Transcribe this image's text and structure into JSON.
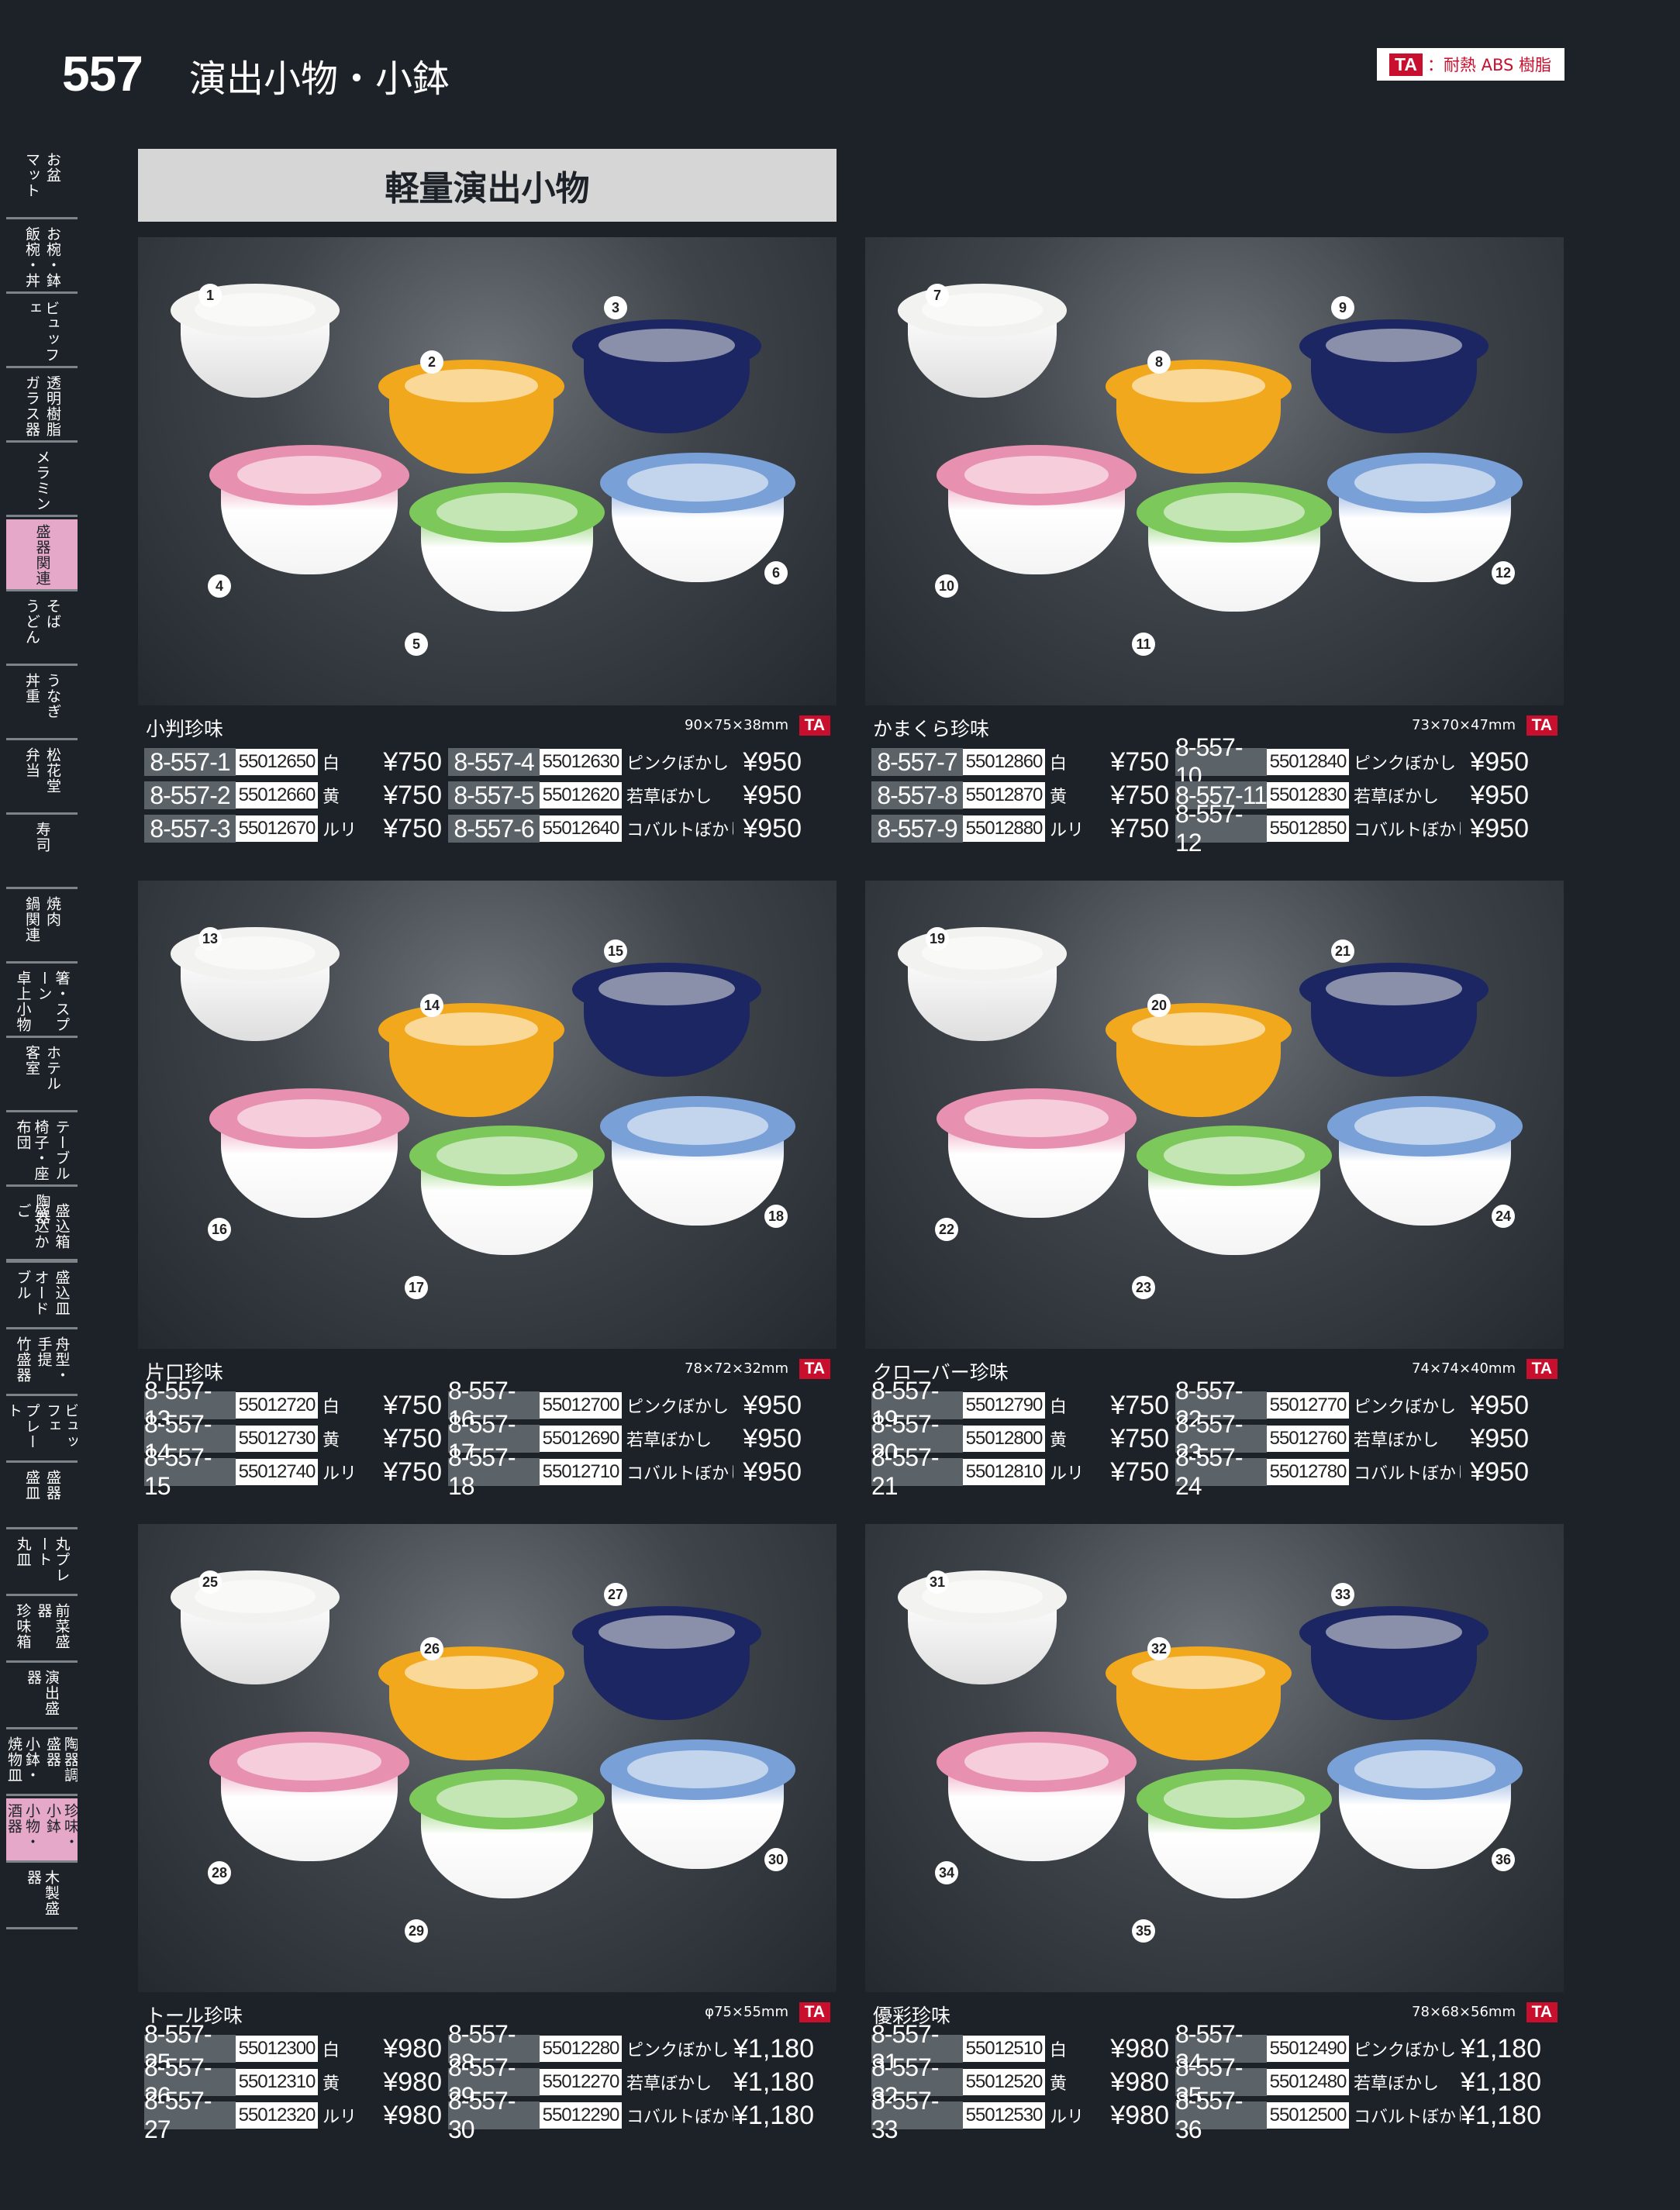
{
  "page": {
    "number": "557",
    "title": "演出小物・小鉢",
    "legend_code": "TA",
    "legend_text": "：耐熱 ABS 樹脂",
    "section": "軽量演出小物"
  },
  "sidebar": [
    {
      "lines": [
        "お盆",
        "マット"
      ]
    },
    {
      "lines": [
        "お椀・鉢",
        "飯椀・丼"
      ]
    },
    {
      "lines": [
        "ビュッフェ"
      ]
    },
    {
      "lines": [
        "透明樹脂",
        "ガラス器"
      ]
    },
    {
      "lines": [
        "メラミン"
      ]
    },
    {
      "lines": [
        "盛器関連"
      ],
      "active": true
    },
    {
      "lines": [
        "そば",
        "うどん"
      ]
    },
    {
      "lines": [
        "うなぎ",
        "丼重"
      ]
    },
    {
      "lines": [
        "松花堂",
        "弁当"
      ]
    },
    {
      "lines": [
        "寿司"
      ]
    },
    {
      "lines": [
        "焼肉",
        "鍋関連"
      ]
    },
    {
      "lines": [
        "箸・スプーン",
        "卓上小物"
      ]
    },
    {
      "lines": [
        "ホテル",
        "客室"
      ]
    },
    {
      "lines": [
        "テーブル",
        "椅子・座布団"
      ]
    },
    {
      "lines": [
        "陶器"
      ]
    },
    {
      "lines": [
        "盛込箱",
        "盛込かご"
      ]
    },
    {
      "lines": [
        "盛込皿",
        "オードブル"
      ]
    },
    {
      "lines": [
        "舟型・手提",
        "竹盛器"
      ]
    },
    {
      "lines": [
        "ビュッフェ",
        "プレート"
      ]
    },
    {
      "lines": [
        "盛器",
        "盛皿"
      ]
    },
    {
      "lines": [
        "丸プレート",
        "丸皿"
      ]
    },
    {
      "lines": [
        "前菜盛器",
        "珍味箱"
      ]
    },
    {
      "lines": [
        "演出盛器"
      ]
    },
    {
      "lines": [
        "陶器調盛器",
        "小鉢・焼物皿"
      ]
    },
    {
      "lines": [
        "珍味・小鉢",
        "小物・酒器"
      ],
      "active": true
    },
    {
      "lines": [
        "木製盛器"
      ]
    }
  ],
  "colors": {
    "white": "#f4f4f2",
    "yellow": "#f2a81c",
    "ruri": "#1e2a6e",
    "pink": "#e890b0",
    "green": "#7cc85a",
    "cobalt": "#7aa0d8"
  },
  "products": [
    {
      "name": "小判珍味",
      "size": "90×75×38mm",
      "badge": "TA",
      "items": [
        {
          "n": "1",
          "code": "8-557-1",
          "jan": "55012650",
          "color": "白",
          "price": "¥750"
        },
        {
          "n": "2",
          "code": "8-557-2",
          "jan": "55012660",
          "color": "黄",
          "price": "¥750"
        },
        {
          "n": "3",
          "code": "8-557-3",
          "jan": "55012670",
          "color": "ルリ",
          "price": "¥750"
        },
        {
          "n": "4",
          "code": "8-557-4",
          "jan": "55012630",
          "color": "ピンクぼかし",
          "price": "¥950"
        },
        {
          "n": "5",
          "code": "8-557-5",
          "jan": "55012620",
          "color": "若草ぼかし",
          "price": "¥950"
        },
        {
          "n": "6",
          "code": "8-557-6",
          "jan": "55012640",
          "color": "コバルトぼかし",
          "price": "¥950"
        }
      ]
    },
    {
      "name": "かまくら珍味",
      "size": "73×70×47mm",
      "badge": "TA",
      "items": [
        {
          "n": "7",
          "code": "8-557-7",
          "jan": "55012860",
          "color": "白",
          "price": "¥750"
        },
        {
          "n": "8",
          "code": "8-557-8",
          "jan": "55012870",
          "color": "黄",
          "price": "¥750"
        },
        {
          "n": "9",
          "code": "8-557-9",
          "jan": "55012880",
          "color": "ルリ",
          "price": "¥750"
        },
        {
          "n": "10",
          "code": "8-557-10",
          "jan": "55012840",
          "color": "ピンクぼかし",
          "price": "¥950"
        },
        {
          "n": "11",
          "code": "8-557-11",
          "jan": "55012830",
          "color": "若草ぼかし",
          "price": "¥950"
        },
        {
          "n": "12",
          "code": "8-557-12",
          "jan": "55012850",
          "color": "コバルトぼかし",
          "price": "¥950"
        }
      ]
    },
    {
      "name": "片口珍味",
      "size": "78×72×32mm",
      "badge": "TA",
      "items": [
        {
          "n": "13",
          "code": "8-557-13",
          "jan": "55012720",
          "color": "白",
          "price": "¥750"
        },
        {
          "n": "14",
          "code": "8-557-14",
          "jan": "55012730",
          "color": "黄",
          "price": "¥750"
        },
        {
          "n": "15",
          "code": "8-557-15",
          "jan": "55012740",
          "color": "ルリ",
          "price": "¥750"
        },
        {
          "n": "16",
          "code": "8-557-16",
          "jan": "55012700",
          "color": "ピンクぼかし",
          "price": "¥950"
        },
        {
          "n": "17",
          "code": "8-557-17",
          "jan": "55012690",
          "color": "若草ぼかし",
          "price": "¥950"
        },
        {
          "n": "18",
          "code": "8-557-18",
          "jan": "55012710",
          "color": "コバルトぼかし",
          "price": "¥950"
        }
      ]
    },
    {
      "name": "クローバー珍味",
      "size": "74×74×40mm",
      "badge": "TA",
      "items": [
        {
          "n": "19",
          "code": "8-557-19",
          "jan": "55012790",
          "color": "白",
          "price": "¥750"
        },
        {
          "n": "20",
          "code": "8-557-20",
          "jan": "55012800",
          "color": "黄",
          "price": "¥750"
        },
        {
          "n": "21",
          "code": "8-557-21",
          "jan": "55012810",
          "color": "ルリ",
          "price": "¥750"
        },
        {
          "n": "22",
          "code": "8-557-22",
          "jan": "55012770",
          "color": "ピンクぼかし",
          "price": "¥950"
        },
        {
          "n": "23",
          "code": "8-557-23",
          "jan": "55012760",
          "color": "若草ぼかし",
          "price": "¥950"
        },
        {
          "n": "24",
          "code": "8-557-24",
          "jan": "55012780",
          "color": "コバルトぼかし",
          "price": "¥950"
        }
      ]
    },
    {
      "name": "トール珍味",
      "size": "φ75×55mm",
      "badge": "TA",
      "items": [
        {
          "n": "25",
          "code": "8-557-25",
          "jan": "55012300",
          "color": "白",
          "price": "¥980"
        },
        {
          "n": "26",
          "code": "8-557-26",
          "jan": "55012310",
          "color": "黄",
          "price": "¥980"
        },
        {
          "n": "27",
          "code": "8-557-27",
          "jan": "55012320",
          "color": "ルリ",
          "price": "¥980"
        },
        {
          "n": "28",
          "code": "8-557-28",
          "jan": "55012280",
          "color": "ピンクぼかし",
          "price": "¥1,180"
        },
        {
          "n": "29",
          "code": "8-557-29",
          "jan": "55012270",
          "color": "若草ぼかし",
          "price": "¥1,180"
        },
        {
          "n": "30",
          "code": "8-557-30",
          "jan": "55012290",
          "color": "コバルトぼかし",
          "price": "¥1,180"
        }
      ]
    },
    {
      "name": "優彩珍味",
      "size": "78×68×56mm",
      "badge": "TA",
      "items": [
        {
          "n": "31",
          "code": "8-557-31",
          "jan": "55012510",
          "color": "白",
          "price": "¥980"
        },
        {
          "n": "32",
          "code": "8-557-32",
          "jan": "55012520",
          "color": "黄",
          "price": "¥980"
        },
        {
          "n": "33",
          "code": "8-557-33",
          "jan": "55012530",
          "color": "ルリ",
          "price": "¥980"
        },
        {
          "n": "34",
          "code": "8-557-34",
          "jan": "55012490",
          "color": "ピンクぼかし",
          "price": "¥1,180"
        },
        {
          "n": "35",
          "code": "8-557-35",
          "jan": "55012480",
          "color": "若草ぼかし",
          "price": "¥1,180"
        },
        {
          "n": "36",
          "code": "8-557-36",
          "jan": "55012500",
          "color": "コバルトぼかし",
          "price": "¥1,180"
        }
      ]
    }
  ]
}
